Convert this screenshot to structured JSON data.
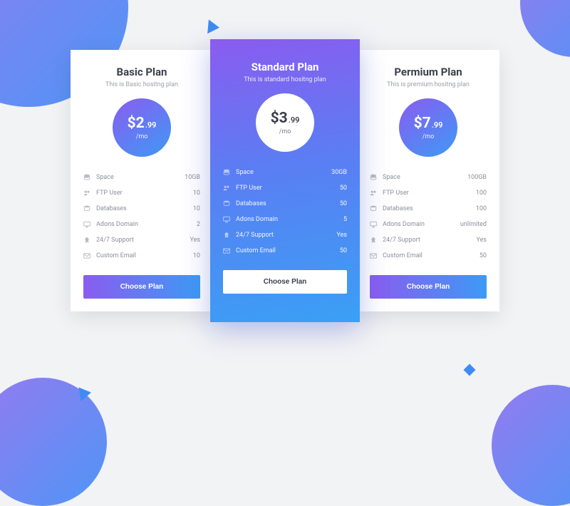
{
  "feature_labels": {
    "space": "Space",
    "ftp": "FTP User",
    "db": "Databases",
    "addon": "Adons Domain",
    "support": "24/7 Support",
    "email": "Custom Email"
  },
  "per": "/mo",
  "choose": "Choose Plan",
  "plans": [
    {
      "title": "Basic Plan",
      "sub": "This is Basic hositng plan",
      "price_main": "$2",
      "price_cents": ".99",
      "space": "10GB",
      "ftp": "10",
      "db": "10",
      "addon": "2",
      "support": "Yes",
      "email": "10"
    },
    {
      "title": "Standard Plan",
      "sub": "This is standard hositng plan",
      "price_main": "$3",
      "price_cents": ".99",
      "space": "30GB",
      "ftp": "50",
      "db": "50",
      "addon": "5",
      "support": "Yes",
      "email": "50"
    },
    {
      "title": "Permium Plan",
      "sub": "This is premium hositng plan",
      "price_main": "$7",
      "price_cents": ".99",
      "space": "100GB",
      "ftp": "100",
      "db": "100",
      "addon": "unlimited",
      "support": "Yes",
      "email": "50"
    }
  ]
}
